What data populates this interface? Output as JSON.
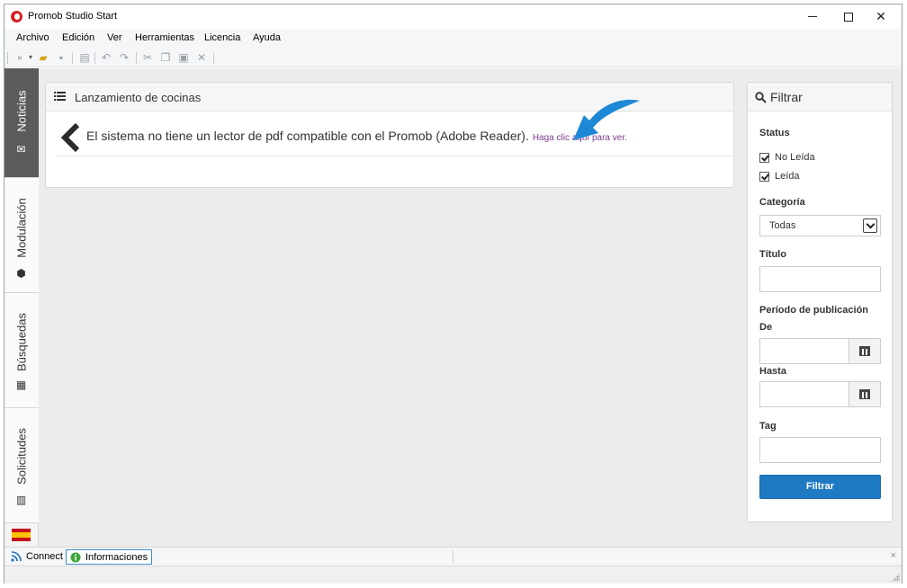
{
  "window": {
    "title": "Promob Studio Start"
  },
  "menu": [
    {
      "label": "Archivo"
    },
    {
      "label": "Edición"
    },
    {
      "label": "Ver"
    },
    {
      "label": "Herramientas"
    },
    {
      "label": "Licencia"
    },
    {
      "label": "Ayuda"
    }
  ],
  "toolbar": {
    "icons": [
      "new-document-icon",
      "open-folder-icon",
      "save-icon",
      "print-icon",
      "undo-icon",
      "redo-icon",
      "cut-icon",
      "copy-icon",
      "paste-icon",
      "delete-icon"
    ]
  },
  "sidetabs": [
    {
      "label": "Noticias",
      "icon": "envelope-icon",
      "active": true
    },
    {
      "label": "Modulación",
      "icon": "cube-icon",
      "active": false
    },
    {
      "label": "Búsquedas",
      "icon": "chart-icon",
      "active": false
    },
    {
      "label": "Solicitudes",
      "icon": "bars-icon",
      "active": false
    }
  ],
  "language": {
    "icon": "spain-flag-icon"
  },
  "news": {
    "title": "Lanzamiento de cocinas",
    "message": "El sistema no tiene un lector de pdf compatible con el Promob (Adobe Reader).",
    "link": "Haga clic aquí para ver.",
    "arrow_color": "#1e88d6"
  },
  "filter": {
    "title": "Filtrar",
    "status_label": "Status",
    "checkbox_unread": "No Leída",
    "checkbox_read": "Leída",
    "unread_checked": true,
    "read_checked": true,
    "category_label": "Categoría",
    "category_value": "Todas",
    "title_label": "Título",
    "title_value": "",
    "period_label": "Período de publicación",
    "from_label": "De",
    "from_value": "",
    "to_label": "Hasta",
    "to_value": "",
    "tag_label": "Tag",
    "tag_value": "",
    "button_label": "Filtrar",
    "button_color": "#1f7ac4"
  },
  "statusbar": {
    "tabs": [
      {
        "label": "Connect",
        "icon": "rss-icon",
        "active": false
      },
      {
        "label": "Informaciones",
        "icon": "info-icon",
        "active": true
      }
    ],
    "close": "×"
  }
}
